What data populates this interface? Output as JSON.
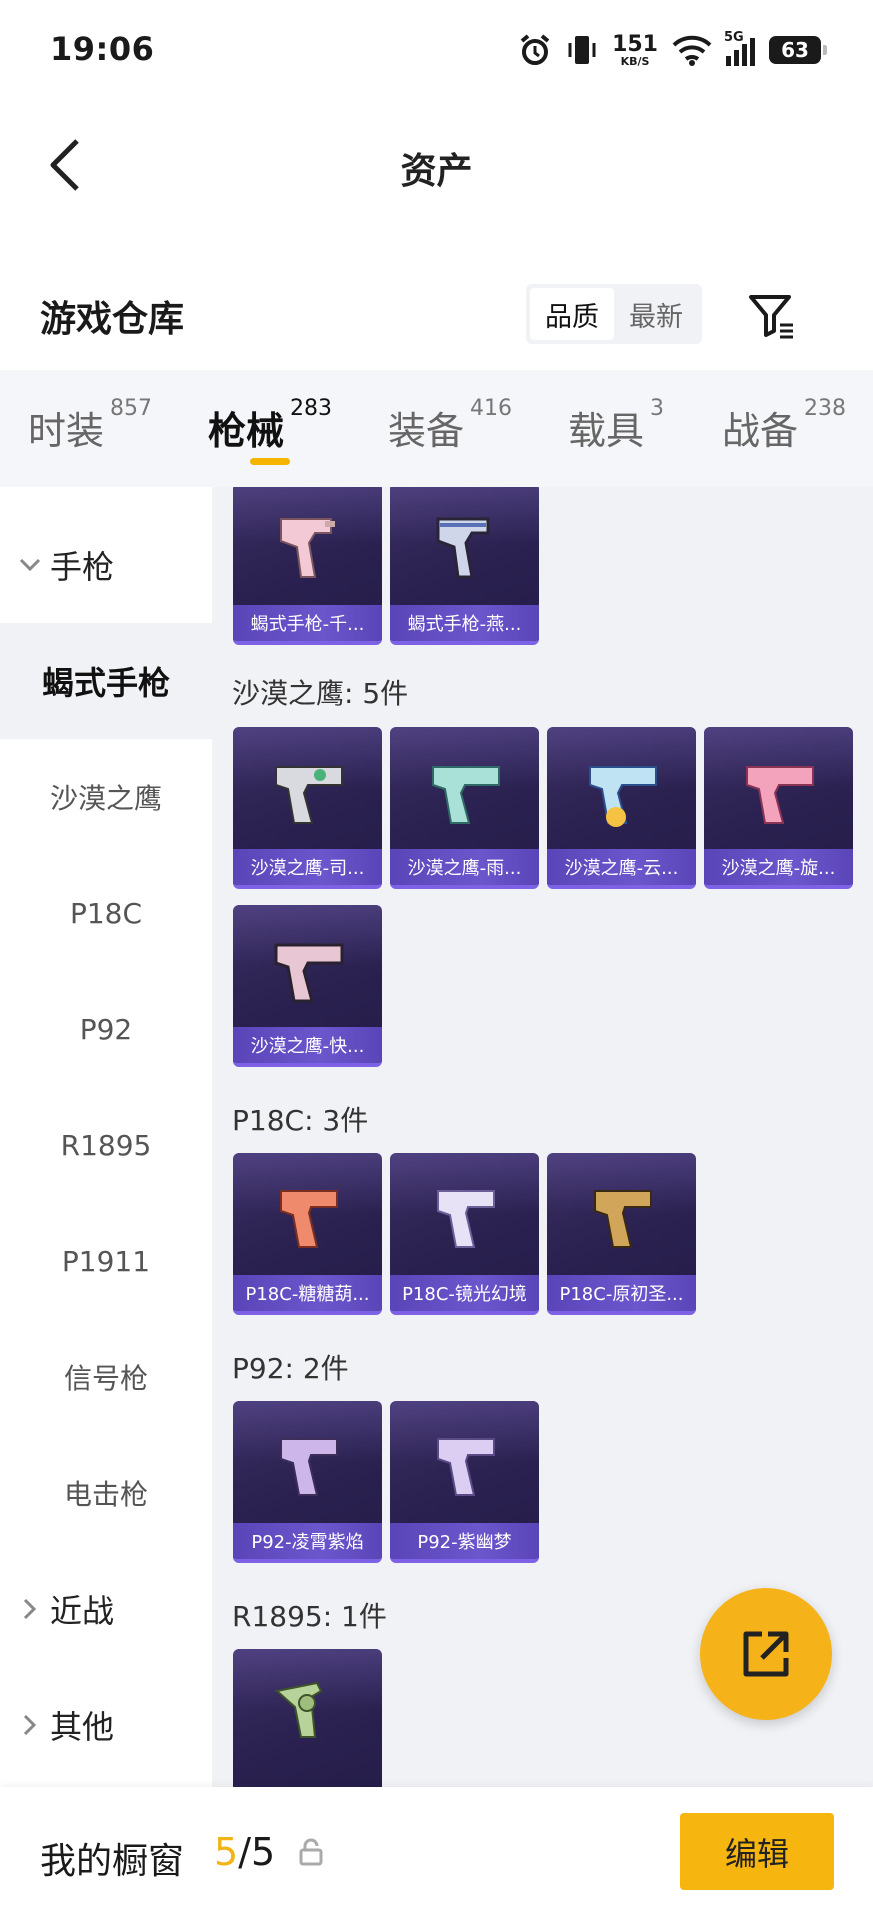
{
  "status": {
    "time": "19:06",
    "net_speed": "151",
    "net_unit": "KB/S",
    "network": "5G",
    "battery": "63"
  },
  "header": {
    "title": "资产"
  },
  "section": {
    "title": "游戏仓库",
    "sort_options": [
      "品质",
      "最新"
    ],
    "sort_active": "品质"
  },
  "tabs": [
    {
      "label": "时装",
      "count": "857"
    },
    {
      "label": "枪械",
      "count": "283",
      "active": true
    },
    {
      "label": "装备",
      "count": "416"
    },
    {
      "label": "载具",
      "count": "3"
    },
    {
      "label": "战备",
      "count": "238"
    }
  ],
  "sidebar": {
    "group_pistol": "手枪",
    "items": [
      "蝎式手枪",
      "沙漠之鹰",
      "P18C",
      "P92",
      "R1895",
      "P1911",
      "信号枪",
      "电击枪"
    ],
    "group_melee": "近战",
    "group_other": "其他"
  },
  "content": {
    "scorpion_cards": [
      "蝎式手枪-千...",
      "蝎式手枪-燕..."
    ],
    "deagle_title": "沙漠之鹰: 5件",
    "deagle_cards": [
      "沙漠之鹰-司...",
      "沙漠之鹰-雨...",
      "沙漠之鹰-云...",
      "沙漠之鹰-旋...",
      "沙漠之鹰-快..."
    ],
    "p18c_title": "P18C: 3件",
    "p18c_cards": [
      "P18C-糖糖葫...",
      "P18C-镜光幻境",
      "P18C-原初圣..."
    ],
    "p92_title": "P92: 2件",
    "p92_cards": [
      "P92-凌霄紫焰",
      "P92-紫幽梦"
    ],
    "r1895_title": "R1895: 1件"
  },
  "bottom": {
    "label": "我的橱窗",
    "current": "5",
    "total": "/5",
    "edit": "编辑"
  },
  "colors": {
    "accent": "#f5b400",
    "card_bg": "#2a2150",
    "card_label": "#5a45b8",
    "content_bg": "#f1f2f5"
  },
  "icons": [
    "back-arrow-icon",
    "filter-icon",
    "chevron-down-icon",
    "chevron-right-icon",
    "share-icon",
    "lock-icon",
    "alarm-icon",
    "vibrate-icon",
    "wifi-icon",
    "signal-icon",
    "battery-icon"
  ]
}
